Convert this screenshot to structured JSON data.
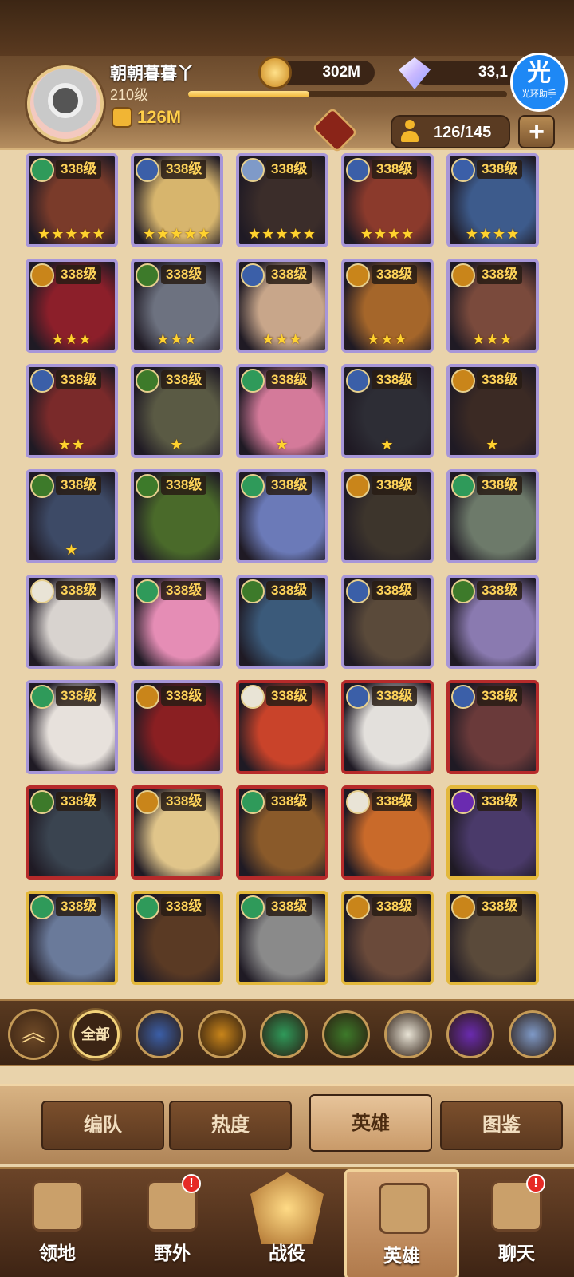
{
  "player": {
    "name": "朝朝暮暮丫",
    "level": "210级",
    "power": "126M",
    "xp_fraction": 0.38
  },
  "currency": {
    "gold": "302M",
    "gems": "33,1"
  },
  "helper": {
    "char": "光",
    "label": "光环助手"
  },
  "roster_count": "126/145",
  "add_label": "+",
  "faction_colors": {
    "forest": "#2f9a5a",
    "light": "#3b5fa8",
    "fire": "#c9851a",
    "grave": "#3d7a2a",
    "celestial": "#e9e4d6",
    "hypogean": "#6a2bb0",
    "dimensional": "#7f9ac8"
  },
  "heroes": [
    {
      "level": "338级",
      "stars": "★★★★★",
      "faction": "forest",
      "tier": "purple",
      "portrait": "#7a3b2a"
    },
    {
      "level": "338级",
      "stars": "★★★★★",
      "faction": "light",
      "tier": "purple",
      "portrait": "#d7b56d"
    },
    {
      "level": "338级",
      "stars": "★★★★★",
      "faction": "dimensional",
      "tier": "purple",
      "portrait": "#3b2d2a"
    },
    {
      "level": "338级",
      "stars": "★★★★",
      "faction": "light",
      "tier": "purple",
      "portrait": "#8b3a2c"
    },
    {
      "level": "338级",
      "stars": "★★★★",
      "faction": "light",
      "tier": "purple",
      "portrait": "#3d5b8c"
    },
    {
      "level": "338级",
      "stars": "★★★",
      "faction": "fire",
      "tier": "purple",
      "portrait": "#8c1f2a"
    },
    {
      "level": "338级",
      "stars": "★★★",
      "faction": "grave",
      "tier": "purple",
      "portrait": "#6d7280"
    },
    {
      "level": "338级",
      "stars": "★★★",
      "faction": "light",
      "tier": "purple",
      "portrait": "#c8a68a"
    },
    {
      "level": "338级",
      "stars": "★★★",
      "faction": "fire",
      "tier": "purple",
      "portrait": "#a5662a"
    },
    {
      "level": "338级",
      "stars": "★★★",
      "faction": "fire",
      "tier": "purple",
      "portrait": "#7a4a3c"
    },
    {
      "level": "338级",
      "stars": "★★",
      "faction": "light",
      "tier": "purple",
      "portrait": "#7a2a2a"
    },
    {
      "level": "338级",
      "stars": "★",
      "faction": "grave",
      "tier": "purple",
      "portrait": "#5a5a44"
    },
    {
      "level": "338级",
      "stars": "★",
      "faction": "forest",
      "tier": "purple",
      "portrait": "#d47a9a"
    },
    {
      "level": "338级",
      "stars": "★",
      "faction": "light",
      "tier": "purple",
      "portrait": "#2d2d35"
    },
    {
      "level": "338级",
      "stars": "★",
      "faction": "fire",
      "tier": "purple",
      "portrait": "#3b2a24"
    },
    {
      "level": "338级",
      "stars": "★",
      "faction": "grave",
      "tier": "purple",
      "portrait": "#3d4a66"
    },
    {
      "level": "338级",
      "stars": "",
      "faction": "grave",
      "tier": "purple",
      "portrait": "#4a6a2a"
    },
    {
      "level": "338级",
      "stars": "",
      "faction": "forest",
      "tier": "purple",
      "portrait": "#6b7ab8"
    },
    {
      "level": "338级",
      "stars": "",
      "faction": "fire",
      "tier": "purple",
      "portrait": "#3d352c"
    },
    {
      "level": "338级",
      "stars": "",
      "faction": "forest",
      "tier": "purple",
      "portrait": "#6d7a6a"
    },
    {
      "level": "338级",
      "stars": "",
      "faction": "celestial",
      "tier": "purple",
      "portrait": "#d8d3cf"
    },
    {
      "level": "338级",
      "stars": "",
      "faction": "forest",
      "tier": "purple",
      "portrait": "#e58db5"
    },
    {
      "level": "338级",
      "stars": "",
      "faction": "grave",
      "tier": "purple",
      "portrait": "#3b5a7a"
    },
    {
      "level": "338级",
      "stars": "",
      "faction": "light",
      "tier": "purple",
      "portrait": "#5a4a3a"
    },
    {
      "level": "338级",
      "stars": "",
      "faction": "grave",
      "tier": "purple",
      "portrait": "#8a7ab0"
    },
    {
      "level": "338级",
      "stars": "",
      "faction": "forest",
      "tier": "purple",
      "portrait": "#e7e1dc"
    },
    {
      "level": "338级",
      "stars": "",
      "faction": "fire",
      "tier": "purple",
      "portrait": "#8a1f22"
    },
    {
      "level": "338级",
      "stars": "",
      "faction": "celestial",
      "tier": "red",
      "portrait": "#c9432a"
    },
    {
      "level": "338级",
      "stars": "",
      "faction": "light",
      "tier": "red",
      "portrait": "#e3e0dc"
    },
    {
      "level": "338级",
      "stars": "",
      "faction": "light",
      "tier": "red",
      "portrait": "#6a3a3a"
    },
    {
      "level": "338级",
      "stars": "",
      "faction": "grave",
      "tier": "red",
      "portrait": "#3a4450"
    },
    {
      "level": "338级",
      "stars": "",
      "faction": "fire",
      "tier": "red",
      "portrait": "#e0c58a"
    },
    {
      "level": "338级",
      "stars": "",
      "faction": "forest",
      "tier": "red",
      "portrait": "#8a5a2a"
    },
    {
      "level": "338级",
      "stars": "",
      "faction": "celestial",
      "tier": "red",
      "portrait": "#c96a2a"
    },
    {
      "level": "338级",
      "stars": "",
      "faction": "hypogean",
      "tier": "gold",
      "portrait": "#4a3a6a"
    },
    {
      "level": "338级",
      "stars": "",
      "faction": "forest",
      "tier": "gold",
      "portrait": "#6a7a9a"
    },
    {
      "level": "338级",
      "stars": "",
      "faction": "forest",
      "tier": "gold",
      "portrait": "#5a3a24"
    },
    {
      "level": "338级",
      "stars": "",
      "faction": "forest",
      "tier": "gold",
      "portrait": "#8a8a8a"
    },
    {
      "level": "338级",
      "stars": "",
      "faction": "fire",
      "tier": "gold",
      "portrait": "#6a4a3a"
    },
    {
      "level": "338级",
      "stars": "",
      "faction": "fire",
      "tier": "gold",
      "portrait": "#5a4a3a"
    }
  ],
  "faction_filter": {
    "collapse_icon": "double-chevron-up-icon",
    "all_label": "全部",
    "chips": [
      "light",
      "fire",
      "forest",
      "grave",
      "celestial",
      "hypogean",
      "dimensional"
    ]
  },
  "sub_tabs": [
    {
      "label": "编队",
      "active": false
    },
    {
      "label": "热度",
      "active": false
    },
    {
      "label": "英雄",
      "active": true
    },
    {
      "label": "图鉴",
      "active": false
    }
  ],
  "bottom_nav": [
    {
      "label": "领地",
      "active": false,
      "alert": ""
    },
    {
      "label": "野外",
      "active": false,
      "alert": "!"
    },
    {
      "label": "战役",
      "active": false,
      "alert": ""
    },
    {
      "label": "英雄",
      "active": true,
      "alert": ""
    },
    {
      "label": "聊天",
      "active": false,
      "alert": "!"
    }
  ]
}
